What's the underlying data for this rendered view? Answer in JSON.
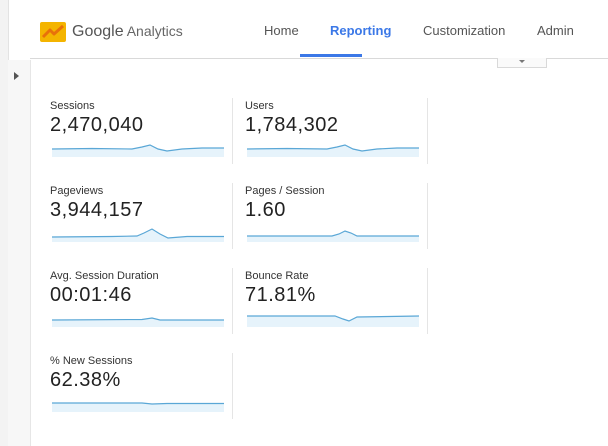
{
  "header": {
    "logo_google": "Google",
    "logo_analytics": "Analytics",
    "nav": [
      {
        "label": "Home",
        "active": false
      },
      {
        "label": "Reporting",
        "active": true
      },
      {
        "label": "Customization",
        "active": false
      },
      {
        "label": "Admin",
        "active": false
      }
    ]
  },
  "metrics": [
    {
      "label": "Sessions",
      "value": "2,470,040"
    },
    {
      "label": "Users",
      "value": "1,784,302"
    },
    {
      "label": "Pageviews",
      "value": "3,944,157"
    },
    {
      "label": "Pages / Session",
      "value": "1.60"
    },
    {
      "label": "Avg. Session Duration",
      "value": "00:01:46"
    },
    {
      "label": "Bounce Rate",
      "value": "71.81%"
    },
    {
      "label": "% New Sessions",
      "value": "62.38%"
    }
  ],
  "colors": {
    "accent": "#3b78e7",
    "sparkline": "#5aa7d6",
    "sparkline_fill": "#e6f3fb"
  },
  "icons": {
    "logo": "google-analytics-logo-icon",
    "sidebar_toggle": "triangle-right-icon",
    "dropdown": "caret-down-icon"
  }
}
